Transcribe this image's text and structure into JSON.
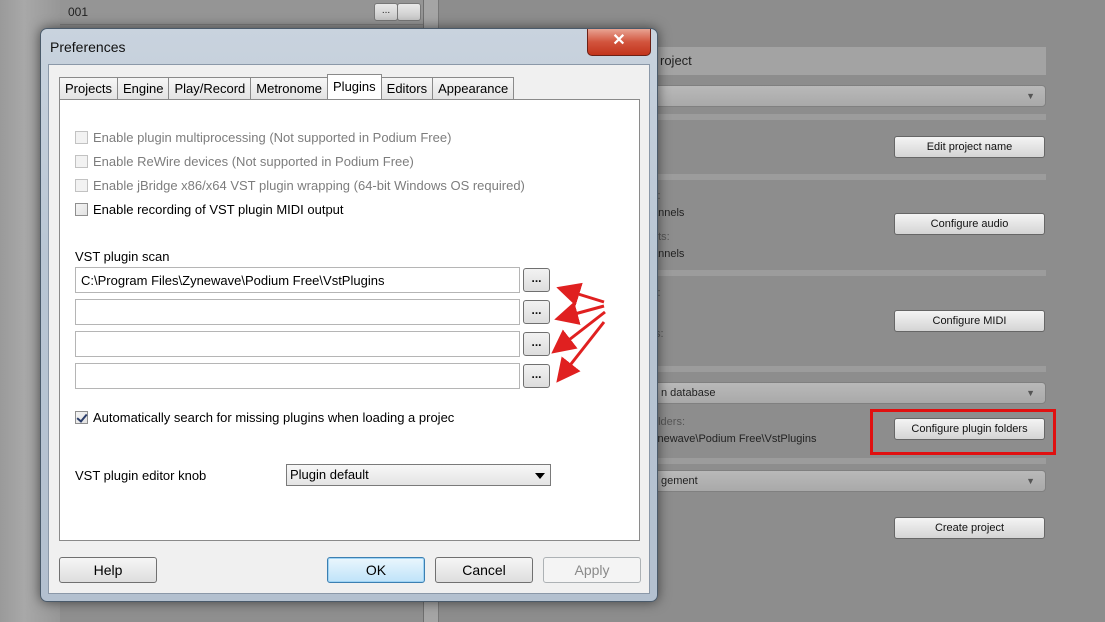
{
  "background": {
    "list_row_number": "001",
    "list_row_btn": "...",
    "panel_header": "roject",
    "dropdowns": [
      "",
      "n database",
      "gement"
    ],
    "texts": {
      "inputs_label": "s:",
      "inputs_value": "annels",
      "outputs_label": "uts:",
      "outputs_value": "annels",
      "midi_in_label": "s:",
      "midi_out_label": "ts:",
      "plugin_folders_label": "olders:",
      "plugin_folders_value": "ynewave\\Podium Free\\VstPlugins"
    },
    "buttons": {
      "edit_project_name": "Edit project name",
      "configure_audio": "Configure audio",
      "configure_midi": "Configure MIDI",
      "configure_plugin_folders": "Configure plugin folders",
      "create_project": "Create project"
    },
    "highlight_color": "#e01010"
  },
  "dialog": {
    "title": "Preferences",
    "close_glyph": "✕",
    "tabs": [
      {
        "label": "Projects"
      },
      {
        "label": "Engine"
      },
      {
        "label": "Play/Record"
      },
      {
        "label": "Metronome"
      },
      {
        "label": "Plugins",
        "active": true
      },
      {
        "label": "Editors"
      },
      {
        "label": "Appearance"
      }
    ],
    "checkboxes": [
      {
        "label": "Enable plugin multiprocessing (Not supported in Podium Free)",
        "checked": false,
        "enabled": false
      },
      {
        "label": "Enable ReWire devices (Not supported in Podium Free)",
        "checked": false,
        "enabled": false
      },
      {
        "label": "Enable jBridge x86/x64 VST plugin wrapping (64-bit Windows OS required)",
        "checked": false,
        "enabled": false
      },
      {
        "label": "Enable recording of VST plugin MIDI output",
        "checked": false,
        "enabled": true
      }
    ],
    "vst_scan_label": "VST plugin scan",
    "vst_paths": [
      "C:\\Program Files\\Zynewave\\Podium Free\\VstPlugins",
      "",
      "",
      ""
    ],
    "browse_label": "...",
    "auto_search_label": "Automatically search for missing plugins when loading a projec",
    "auto_search_checked": true,
    "knob_label": "VST plugin editor knob",
    "knob_value": "Plugin default",
    "buttons": {
      "help": "Help",
      "ok": "OK",
      "cancel": "Cancel",
      "apply": "Apply"
    }
  },
  "annotation_arrow_color": "#e02020"
}
